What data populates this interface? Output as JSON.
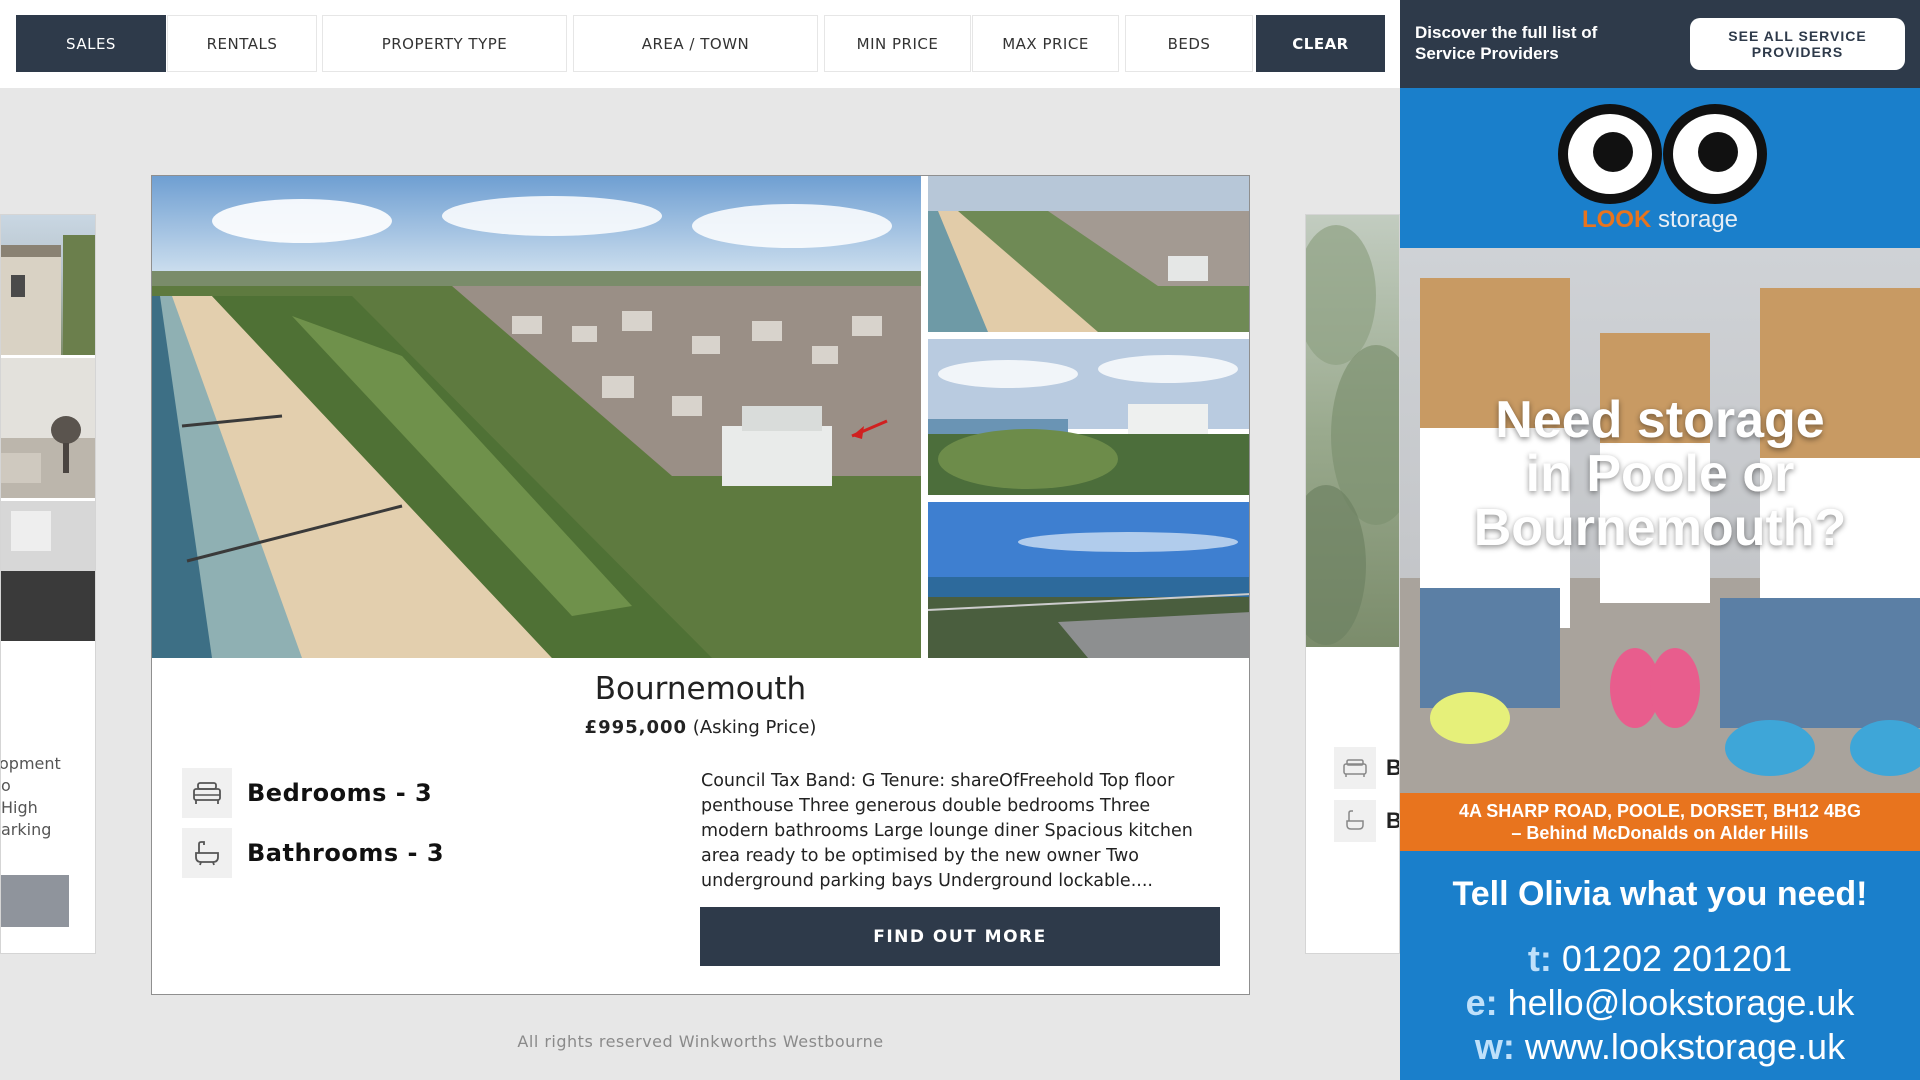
{
  "filters": [
    {
      "label": "SALES",
      "active": true
    },
    {
      "label": "RENTALS"
    },
    {
      "label": "PROPERTY TYPE"
    },
    {
      "label": "AREA / TOWN"
    },
    {
      "label": "MIN PRICE"
    },
    {
      "label": "MAX PRICE"
    },
    {
      "label": "BEDS"
    }
  ],
  "clear_label": "CLEAR",
  "prev_card": {
    "text_lines": [
      "opment",
      "o",
      "High",
      "arking"
    ]
  },
  "next_card": {
    "feature_initials": [
      "B",
      "B"
    ]
  },
  "listing": {
    "town": "Bournemouth",
    "price": "£995,000",
    "price_qualifier": "(Asking Price)",
    "bedrooms": "Bedrooms - 3",
    "bathrooms": "Bathrooms - 3",
    "description": "Council Tax Band: G Tenure: shareOfFreehold Top floor penthouse Three generous double bedrooms Three modern bathrooms Large lounge diner Spacious kitchen area ready to be optimised by the new owner Two underground parking bays Underground lockable....",
    "cta": "FIND OUT MORE"
  },
  "footer": "All rights reserved Winkworths Westbourne",
  "advert": {
    "header_text": "Discover the full list of Service Providers",
    "header_button": "SEE ALL SERVICE PROVIDERS",
    "logo_look": "LOOK",
    "logo_storage": "storage",
    "headline_1": "Need storage",
    "headline_2": "in Poole or",
    "headline_3": "Bournemouth?",
    "address_1": "4A SHARP ROAD, POOLE, DORSET, BH12 4BG",
    "address_2": "– Behind McDonalds on Alder Hills",
    "tagline": "Tell Olivia what you need!",
    "phone_label": "t:",
    "phone": "01202 201201",
    "email_label": "e:",
    "email": "hello@lookstorage.uk",
    "web_label": "w:",
    "web": "www.lookstorage.uk"
  },
  "colors": {
    "navy": "#2e3a4a",
    "ad_blue": "#1a7fcb",
    "ad_orange": "#e8741e"
  }
}
